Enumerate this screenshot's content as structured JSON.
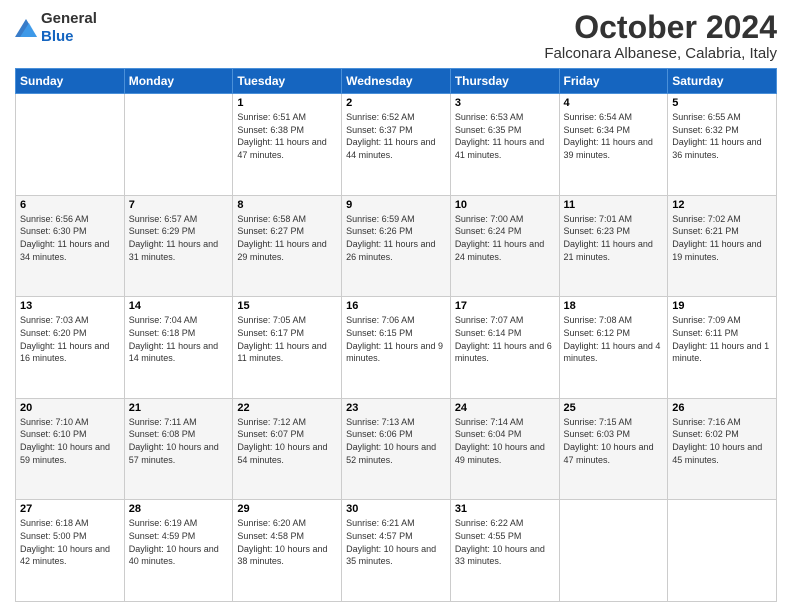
{
  "logo": {
    "general": "General",
    "blue": "Blue"
  },
  "title": "October 2024",
  "subtitle": "Falconara Albanese, Calabria, Italy",
  "days_of_week": [
    "Sunday",
    "Monday",
    "Tuesday",
    "Wednesday",
    "Thursday",
    "Friday",
    "Saturday"
  ],
  "weeks": [
    [
      {
        "day": "",
        "info": ""
      },
      {
        "day": "",
        "info": ""
      },
      {
        "day": "1",
        "info": "Sunrise: 6:51 AM\nSunset: 6:38 PM\nDaylight: 11 hours and 47 minutes."
      },
      {
        "day": "2",
        "info": "Sunrise: 6:52 AM\nSunset: 6:37 PM\nDaylight: 11 hours and 44 minutes."
      },
      {
        "day": "3",
        "info": "Sunrise: 6:53 AM\nSunset: 6:35 PM\nDaylight: 11 hours and 41 minutes."
      },
      {
        "day": "4",
        "info": "Sunrise: 6:54 AM\nSunset: 6:34 PM\nDaylight: 11 hours and 39 minutes."
      },
      {
        "day": "5",
        "info": "Sunrise: 6:55 AM\nSunset: 6:32 PM\nDaylight: 11 hours and 36 minutes."
      }
    ],
    [
      {
        "day": "6",
        "info": "Sunrise: 6:56 AM\nSunset: 6:30 PM\nDaylight: 11 hours and 34 minutes."
      },
      {
        "day": "7",
        "info": "Sunrise: 6:57 AM\nSunset: 6:29 PM\nDaylight: 11 hours and 31 minutes."
      },
      {
        "day": "8",
        "info": "Sunrise: 6:58 AM\nSunset: 6:27 PM\nDaylight: 11 hours and 29 minutes."
      },
      {
        "day": "9",
        "info": "Sunrise: 6:59 AM\nSunset: 6:26 PM\nDaylight: 11 hours and 26 minutes."
      },
      {
        "day": "10",
        "info": "Sunrise: 7:00 AM\nSunset: 6:24 PM\nDaylight: 11 hours and 24 minutes."
      },
      {
        "day": "11",
        "info": "Sunrise: 7:01 AM\nSunset: 6:23 PM\nDaylight: 11 hours and 21 minutes."
      },
      {
        "day": "12",
        "info": "Sunrise: 7:02 AM\nSunset: 6:21 PM\nDaylight: 11 hours and 19 minutes."
      }
    ],
    [
      {
        "day": "13",
        "info": "Sunrise: 7:03 AM\nSunset: 6:20 PM\nDaylight: 11 hours and 16 minutes."
      },
      {
        "day": "14",
        "info": "Sunrise: 7:04 AM\nSunset: 6:18 PM\nDaylight: 11 hours and 14 minutes."
      },
      {
        "day": "15",
        "info": "Sunrise: 7:05 AM\nSunset: 6:17 PM\nDaylight: 11 hours and 11 minutes."
      },
      {
        "day": "16",
        "info": "Sunrise: 7:06 AM\nSunset: 6:15 PM\nDaylight: 11 hours and 9 minutes."
      },
      {
        "day": "17",
        "info": "Sunrise: 7:07 AM\nSunset: 6:14 PM\nDaylight: 11 hours and 6 minutes."
      },
      {
        "day": "18",
        "info": "Sunrise: 7:08 AM\nSunset: 6:12 PM\nDaylight: 11 hours and 4 minutes."
      },
      {
        "day": "19",
        "info": "Sunrise: 7:09 AM\nSunset: 6:11 PM\nDaylight: 11 hours and 1 minute."
      }
    ],
    [
      {
        "day": "20",
        "info": "Sunrise: 7:10 AM\nSunset: 6:10 PM\nDaylight: 10 hours and 59 minutes."
      },
      {
        "day": "21",
        "info": "Sunrise: 7:11 AM\nSunset: 6:08 PM\nDaylight: 10 hours and 57 minutes."
      },
      {
        "day": "22",
        "info": "Sunrise: 7:12 AM\nSunset: 6:07 PM\nDaylight: 10 hours and 54 minutes."
      },
      {
        "day": "23",
        "info": "Sunrise: 7:13 AM\nSunset: 6:06 PM\nDaylight: 10 hours and 52 minutes."
      },
      {
        "day": "24",
        "info": "Sunrise: 7:14 AM\nSunset: 6:04 PM\nDaylight: 10 hours and 49 minutes."
      },
      {
        "day": "25",
        "info": "Sunrise: 7:15 AM\nSunset: 6:03 PM\nDaylight: 10 hours and 47 minutes."
      },
      {
        "day": "26",
        "info": "Sunrise: 7:16 AM\nSunset: 6:02 PM\nDaylight: 10 hours and 45 minutes."
      }
    ],
    [
      {
        "day": "27",
        "info": "Sunrise: 6:18 AM\nSunset: 5:00 PM\nDaylight: 10 hours and 42 minutes."
      },
      {
        "day": "28",
        "info": "Sunrise: 6:19 AM\nSunset: 4:59 PM\nDaylight: 10 hours and 40 minutes."
      },
      {
        "day": "29",
        "info": "Sunrise: 6:20 AM\nSunset: 4:58 PM\nDaylight: 10 hours and 38 minutes."
      },
      {
        "day": "30",
        "info": "Sunrise: 6:21 AM\nSunset: 4:57 PM\nDaylight: 10 hours and 35 minutes."
      },
      {
        "day": "31",
        "info": "Sunrise: 6:22 AM\nSunset: 4:55 PM\nDaylight: 10 hours and 33 minutes."
      },
      {
        "day": "",
        "info": ""
      },
      {
        "day": "",
        "info": ""
      }
    ]
  ]
}
